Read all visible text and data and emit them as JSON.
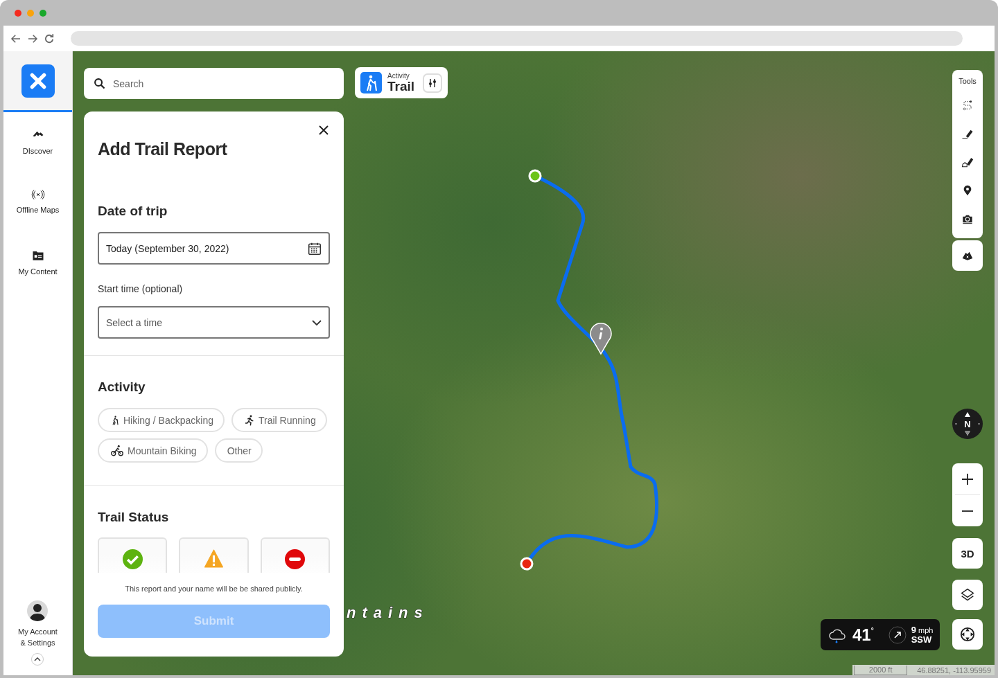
{
  "sidebar": {
    "items": [
      {
        "label": "DIscover",
        "kind": "discover"
      },
      {
        "label": "Offline Maps",
        "kind": "offline"
      },
      {
        "label": "My Content",
        "kind": "content"
      }
    ],
    "account": {
      "label_lines": [
        "My Account",
        "& Settings"
      ]
    }
  },
  "search": {
    "placeholder": "Search"
  },
  "activity_filter": {
    "caption": "Activity",
    "value": "Trail"
  },
  "report_panel": {
    "title": "Add Trail Report",
    "date_of_trip": {
      "heading": "Date of trip",
      "value": "Today (September 30, 2022)"
    },
    "start_time": {
      "label": "Start time (optional)",
      "placeholder": "Select a time"
    },
    "activity": {
      "heading": "Activity",
      "options": [
        {
          "label": "Hiking / Backpacking",
          "kind": "hiking"
        },
        {
          "label": "Trail Running",
          "kind": "running"
        },
        {
          "label": "Mountain Biking",
          "kind": "biking"
        },
        {
          "label": "Other",
          "kind": "other"
        }
      ]
    },
    "trail_status": {
      "heading": "Trail Status",
      "options": [
        {
          "kind": "open"
        },
        {
          "kind": "caution"
        },
        {
          "kind": "closed"
        }
      ]
    },
    "notice": "This report and your name will be be shared publicly.",
    "submit": {
      "label": "Submit",
      "disabled": true
    }
  },
  "tools": {
    "title": "Tools"
  },
  "map_controls": {
    "compass": "N",
    "three_d": "3D"
  },
  "weather": {
    "temperature": "41",
    "degree": "°",
    "wind_speed": "9",
    "wind_unit": "mph",
    "wind_direction": "SSW"
  },
  "map_label": "ntains",
  "scale": "2000 ft",
  "coordinates": "46.88251, -113.95959"
}
